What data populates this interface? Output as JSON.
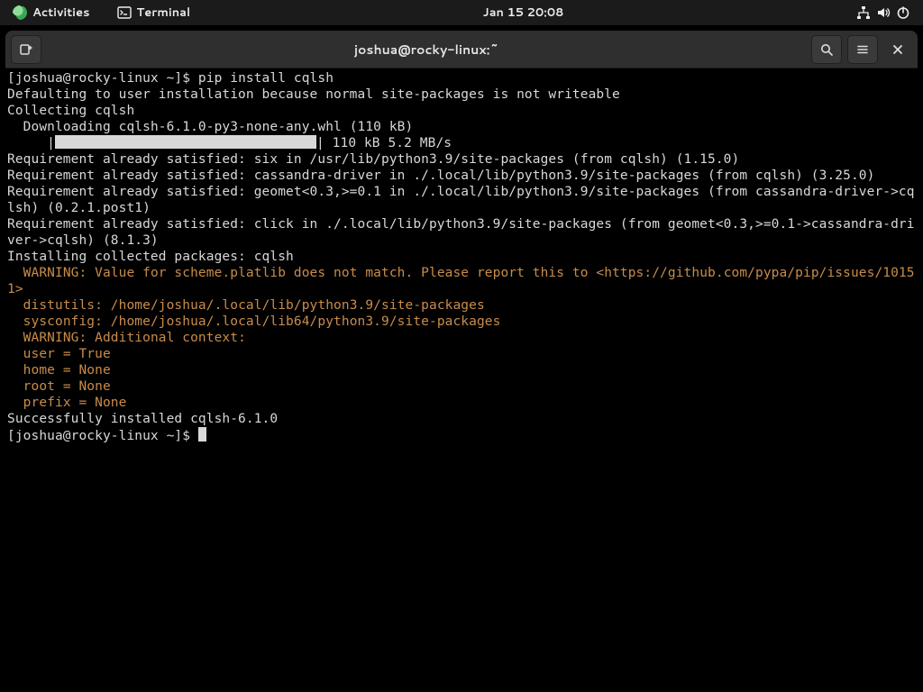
{
  "topbar": {
    "activities": "Activities",
    "terminal_label": "Terminal",
    "clock": "Jan 15  20:08"
  },
  "window": {
    "title": "joshua@rocky-linux:~"
  },
  "term": {
    "prompt1": "[joshua@rocky-linux ~]$ ",
    "cmd1": "pip install cqlsh",
    "l2": "Defaulting to user installation because normal site-packages is not writeable",
    "l3": "Collecting cqlsh",
    "l4": "  Downloading cqlsh-6.1.0-py3-none-any.whl (110 kB)",
    "progress_prefix": "     |",
    "progress_suffix": "| 110 kB 5.2 MB/s",
    "l6": "Requirement already satisfied: six in /usr/lib/python3.9/site-packages (from cqlsh) (1.15.0)",
    "l7": "Requirement already satisfied: cassandra-driver in ./.local/lib/python3.9/site-packages (from cqlsh) (3.25.0)",
    "l8": "Requirement already satisfied: geomet<0.3,>=0.1 in ./.local/lib/python3.9/site-packages (from cassandra-driver->cqlsh) (0.2.1.post1)",
    "l9": "Requirement already satisfied: click in ./.local/lib/python3.9/site-packages (from geomet<0.3,>=0.1->cassandra-driver->cqlsh) (8.1.3)",
    "l10": "Installing collected packages: cqlsh",
    "w1": "  WARNING: Value for scheme.platlib does not match. Please report this to <https://github.com/pypa/pip/issues/10151>",
    "w2": "  distutils: /home/joshua/.local/lib/python3.9/site-packages",
    "w3": "  sysconfig: /home/joshua/.local/lib64/python3.9/site-packages",
    "w4": "  WARNING: Additional context:",
    "w5": "  user = True",
    "w6": "  home = None",
    "w7": "  root = None",
    "w8": "  prefix = None",
    "l11": "Successfully installed cqlsh-6.1.0",
    "prompt2": "[joshua@rocky-linux ~]$ "
  }
}
